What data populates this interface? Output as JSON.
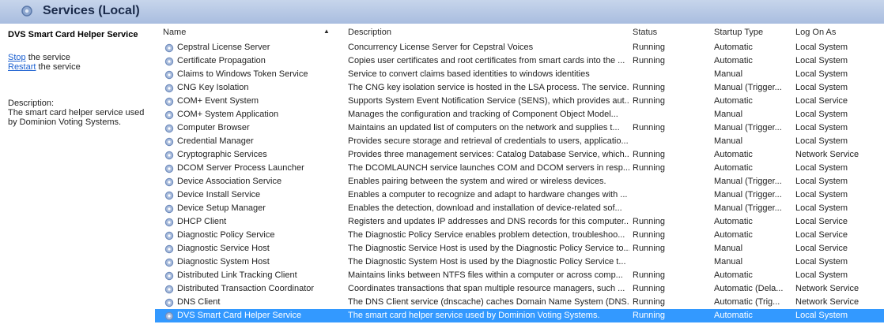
{
  "window": {
    "title": "Services (Local)"
  },
  "left_panel": {
    "service_name": "DVS Smart Card Helper Service",
    "stop_link": "Stop",
    "stop_suffix": " the service",
    "restart_link": "Restart",
    "restart_suffix": " the service",
    "description_label": "Description:",
    "description_text": "The smart card helper service used by Dominion Voting Systems."
  },
  "table": {
    "columns": [
      "Name",
      "Description",
      "Status",
      "Startup Type",
      "Log On As"
    ],
    "rows": [
      {
        "name": "Cepstral License Server",
        "description": "Concurrency License Server for Cepstral Voices",
        "status": "Running",
        "startup": "Automatic",
        "logon": "Local System"
      },
      {
        "name": "Certificate Propagation",
        "description": "Copies user certificates and root certificates from smart cards into the ...",
        "status": "Running",
        "startup": "Automatic",
        "logon": "Local System"
      },
      {
        "name": "Claims to Windows Token Service",
        "description": "Service to convert claims based identities to windows identities",
        "status": "",
        "startup": "Manual",
        "logon": "Local System"
      },
      {
        "name": "CNG Key Isolation",
        "description": "The CNG key isolation service is hosted in the LSA process. The service...",
        "status": "Running",
        "startup": "Manual (Trigger...",
        "logon": "Local System"
      },
      {
        "name": "COM+ Event System",
        "description": "Supports System Event Notification Service (SENS), which provides aut...",
        "status": "Running",
        "startup": "Automatic",
        "logon": "Local Service"
      },
      {
        "name": "COM+ System Application",
        "description": "Manages the configuration and tracking of Component Object Model...",
        "status": "",
        "startup": "Manual",
        "logon": "Local System"
      },
      {
        "name": "Computer Browser",
        "description": "Maintains an updated list of computers on the network and supplies t...",
        "status": "Running",
        "startup": "Manual (Trigger...",
        "logon": "Local System"
      },
      {
        "name": "Credential Manager",
        "description": "Provides secure storage and retrieval of credentials to users, applicatio...",
        "status": "",
        "startup": "Manual",
        "logon": "Local System"
      },
      {
        "name": "Cryptographic Services",
        "description": "Provides three management services: Catalog Database Service, which...",
        "status": "Running",
        "startup": "Automatic",
        "logon": "Network Service"
      },
      {
        "name": "DCOM Server Process Launcher",
        "description": "The DCOMLAUNCH service launches COM and DCOM servers in resp...",
        "status": "Running",
        "startup": "Automatic",
        "logon": "Local System"
      },
      {
        "name": "Device Association Service",
        "description": "Enables pairing between the system and wired or wireless devices.",
        "status": "",
        "startup": "Manual (Trigger...",
        "logon": "Local System"
      },
      {
        "name": "Device Install Service",
        "description": "Enables a computer to recognize and adapt to hardware changes with ...",
        "status": "",
        "startup": "Manual (Trigger...",
        "logon": "Local System"
      },
      {
        "name": "Device Setup Manager",
        "description": "Enables the detection, download and installation of device-related sof...",
        "status": "",
        "startup": "Manual (Trigger...",
        "logon": "Local System"
      },
      {
        "name": "DHCP Client",
        "description": "Registers and updates IP addresses and DNS records for this computer...",
        "status": "Running",
        "startup": "Automatic",
        "logon": "Local Service"
      },
      {
        "name": "Diagnostic Policy Service",
        "description": "The Diagnostic Policy Service enables problem detection, troubleshoo...",
        "status": "Running",
        "startup": "Automatic",
        "logon": "Local Service"
      },
      {
        "name": "Diagnostic Service Host",
        "description": "The Diagnostic Service Host is used by the Diagnostic Policy Service to...",
        "status": "Running",
        "startup": "Manual",
        "logon": "Local Service"
      },
      {
        "name": "Diagnostic System Host",
        "description": "The Diagnostic System Host is used by the Diagnostic Policy Service t...",
        "status": "",
        "startup": "Manual",
        "logon": "Local System"
      },
      {
        "name": "Distributed Link Tracking Client",
        "description": "Maintains links between NTFS files within a computer or across comp...",
        "status": "Running",
        "startup": "Automatic",
        "logon": "Local System"
      },
      {
        "name": "Distributed Transaction Coordinator",
        "description": "Coordinates transactions that span multiple resource managers, such ...",
        "status": "Running",
        "startup": "Automatic (Dela...",
        "logon": "Network Service"
      },
      {
        "name": "DNS Client",
        "description": "The DNS Client service (dnscache) caches Domain Name System (DNS...",
        "status": "Running",
        "startup": "Automatic (Trig...",
        "logon": "Network Service"
      },
      {
        "name": "DVS Smart Card Helper Service",
        "description": "The smart card helper service used by Dominion Voting Systems.",
        "status": "Running",
        "startup": "Automatic",
        "logon": "Local System"
      }
    ],
    "selected_index": 20
  },
  "colors": {
    "selection": "#3399ff",
    "link": "#1a5fd0",
    "title_bar": "#b7c9e6"
  },
  "icons": {
    "title": "services-gear-icon",
    "row": "service-gear-icon"
  }
}
